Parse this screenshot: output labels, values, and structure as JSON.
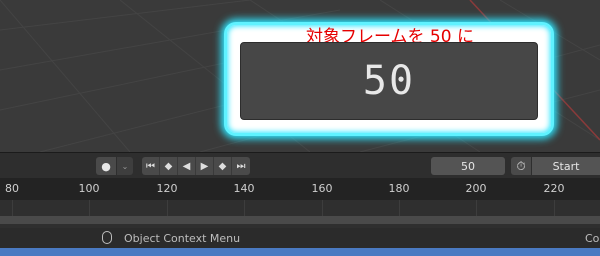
{
  "callout": {
    "title": "対象フレームを 50 に",
    "value": "50"
  },
  "timeline": {
    "current_frame": "50",
    "start_label": "Start",
    "record_icon": "record-dot-icon",
    "playback_icons": [
      "jump-start-icon",
      "prev-keyframe-icon",
      "play-reverse-icon",
      "play-icon",
      "next-keyframe-icon",
      "jump-end-icon"
    ]
  },
  "ruler": {
    "ticks": [
      "80",
      "100",
      "120",
      "140",
      "160",
      "180",
      "200",
      "220"
    ]
  },
  "statusbar": {
    "context_menu": "Object Context Menu",
    "right_text": "Col"
  },
  "colors": {
    "callout_text": "#e60000",
    "callout_border": "#5ff2ff",
    "bottom_strip": "#4a7ac2"
  }
}
